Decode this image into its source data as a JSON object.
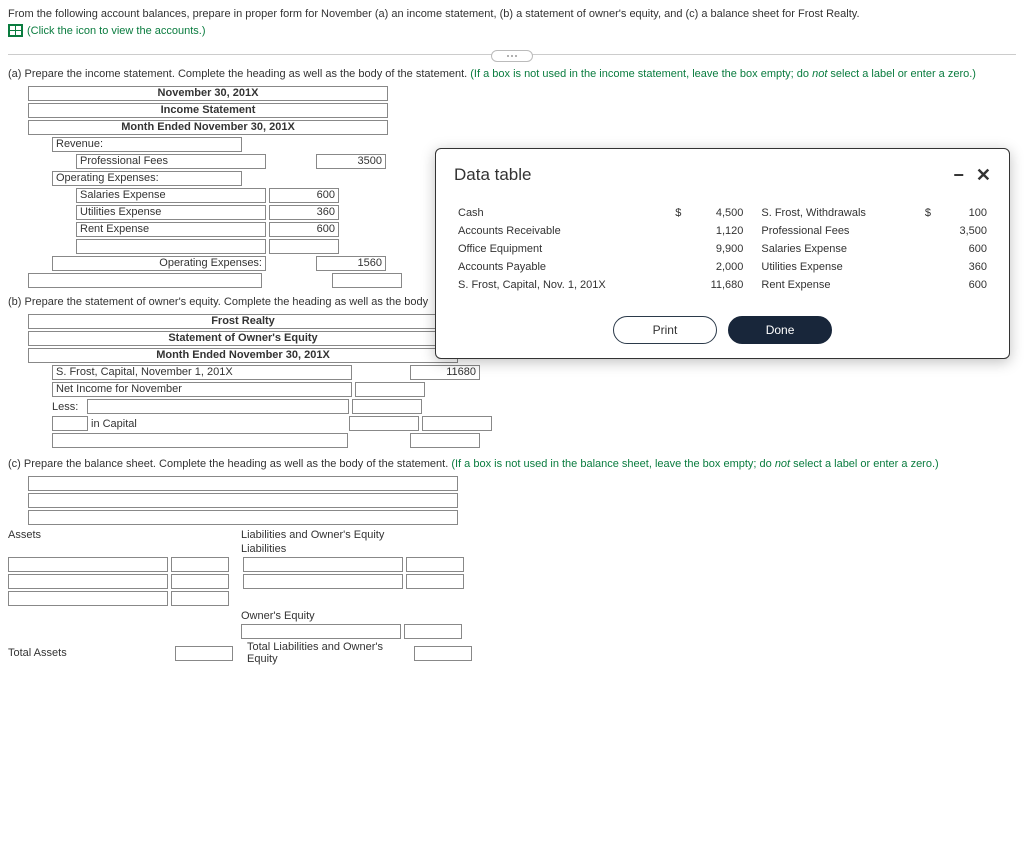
{
  "intro": {
    "text": "From the following account balances, prepare in proper form for November (a) an income statement, (b) a statement of owner's equity, and (c) a balance sheet for Frost Realty.",
    "link_text": "(Click the icon to view the accounts.)"
  },
  "sectionA": {
    "prompt": "(a) Prepare the income statement. Complete the heading as well as the body of the statement.",
    "hint": "(If a box is not used in the income statement, leave the box empty; do not select a label or enter a zero.)",
    "heading_lines": [
      "November 30, 201X",
      "Income Statement",
      "Month Ended November 30, 201X"
    ],
    "rows": {
      "revenue_label": "Revenue:",
      "prof_fees_label": "Professional Fees",
      "prof_fees_val": "3500",
      "opex_label": "Operating Expenses:",
      "salaries_label": "Salaries Expense",
      "salaries_val": "600",
      "utilities_label": "Utilities Expense",
      "utilities_val": "360",
      "rent_label": "Rent Expense",
      "rent_val": "600",
      "opex_total_label": "Operating Expenses:",
      "opex_total_val": "1560"
    }
  },
  "sectionB": {
    "prompt": "(b) Prepare the statement of owner's equity. Complete the heading as well as the body",
    "heading_lines": [
      "Frost Realty",
      "Statement of Owner's Equity",
      "Month Ended November 30, 201X"
    ],
    "rows": {
      "cap_begin_label": "S. Frost, Capital, November 1, 201X",
      "cap_begin_val": "11680",
      "netinc_label": "Net Income for November",
      "less_label": "Less:",
      "in_cap": "in Capital"
    }
  },
  "sectionC": {
    "prompt": "(c) Prepare the balance sheet. Complete the heading as well as the body of the statement.",
    "hint": "(If a box is not used in the balance sheet, leave the box empty; do not select a label or enter a zero.)",
    "labels": {
      "assets": "Assets",
      "liab_oe": "Liabilities and Owner's Equity",
      "liab": "Liabilities",
      "oe": "Owner's Equity",
      "total_assets": "Total Assets",
      "total_liab_oe": "Total Liabilities and Owner's Equity"
    }
  },
  "modal": {
    "title": "Data table",
    "rows": [
      {
        "l": "Cash",
        "cur1": "$",
        "lv": "4,500",
        "r": "S. Frost, Withdrawals",
        "cur2": "$",
        "rv": "100"
      },
      {
        "l": "Accounts Receivable",
        "cur1": "",
        "lv": "1,120",
        "r": "Professional Fees",
        "cur2": "",
        "rv": "3,500"
      },
      {
        "l": "Office Equipment",
        "cur1": "",
        "lv": "9,900",
        "r": "Salaries Expense",
        "cur2": "",
        "rv": "600"
      },
      {
        "l": "Accounts Payable",
        "cur1": "",
        "lv": "2,000",
        "r": "Utilities Expense",
        "cur2": "",
        "rv": "360"
      },
      {
        "l": "S. Frost, Capital, Nov. 1, 201X",
        "cur1": "",
        "lv": "11,680",
        "r": "Rent Expense",
        "cur2": "",
        "rv": "600"
      }
    ],
    "btn_print": "Print",
    "btn_done": "Done"
  }
}
